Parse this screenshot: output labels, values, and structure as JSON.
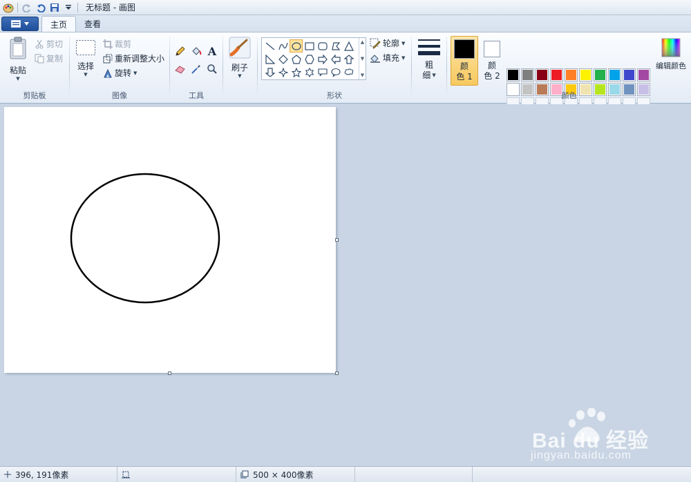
{
  "window": {
    "title": "无标题 - 画图"
  },
  "tabs": [
    {
      "label": "主页",
      "active": true
    },
    {
      "label": "查看",
      "active": false
    }
  ],
  "clipboard": {
    "paste": "粘贴",
    "cut": "剪切",
    "copy": "复制",
    "group": "剪贴板"
  },
  "image": {
    "select": "选择",
    "crop": "裁剪",
    "resize": "重新调整大小",
    "rotate": "旋转",
    "group": "图像"
  },
  "tools": {
    "group": "工具",
    "text_glyph": "A"
  },
  "brushes": {
    "label": "刷子"
  },
  "shapes": {
    "outline": "轮廓",
    "fill": "填充",
    "group": "形状",
    "selected": "oval"
  },
  "size": {
    "label_line1": "粗",
    "label_line2": "细"
  },
  "colors": {
    "color1_line1": "颜",
    "color1_line2": "色 1",
    "color2_line1": "颜",
    "color2_line2": "色 2",
    "edit": "编辑颜色",
    "group": "颜色",
    "color1_value": "#000000",
    "color2_value": "#ffffff",
    "row1": [
      "#000000",
      "#7f7f7f",
      "#880015",
      "#ed1c24",
      "#ff7f27",
      "#fff200",
      "#22b14c",
      "#00a2e8",
      "#3f48cc",
      "#a349a4"
    ],
    "row2": [
      "#ffffff",
      "#c3c3c3",
      "#b97a57",
      "#ffaec9",
      "#ffc90e",
      "#efe4b0",
      "#b5e61d",
      "#99d9ea",
      "#7092be",
      "#c8bfe7"
    ]
  },
  "status": {
    "cursor": "396, 191像素",
    "selection": "",
    "canvas_size": "500 × 400像素"
  },
  "watermark": {
    "brand": "Bai du 经验",
    "url": "jingyan.baidu.com"
  }
}
